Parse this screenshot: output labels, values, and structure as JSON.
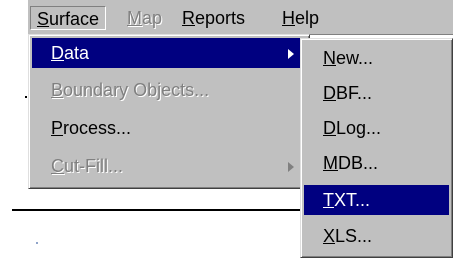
{
  "menubar": {
    "items": [
      {
        "accel": "S",
        "rest": "urface"
      },
      {
        "accel": "M",
        "rest": "ap"
      },
      {
        "accel": "R",
        "rest": "eports"
      },
      {
        "accel": "H",
        "rest": "elp"
      }
    ]
  },
  "surface_menu": {
    "items": [
      {
        "accel": "D",
        "rest": "ata"
      },
      {
        "accel": "B",
        "rest": "oundary Objects..."
      },
      {
        "accel": "P",
        "rest": "rocess..."
      },
      {
        "accel": "C",
        "rest": "ut-Fill..."
      }
    ]
  },
  "data_submenu": {
    "items": [
      {
        "accel": "N",
        "rest": "ew..."
      },
      {
        "accel": "D",
        "rest": "BF..."
      },
      {
        "accel": "D",
        "rest": "Log..."
      },
      {
        "accel": "M",
        "rest": "DB..."
      },
      {
        "accel": "T",
        "rest": "XT..."
      },
      {
        "accel": "X",
        "rest": "LS..."
      }
    ]
  },
  "colors": {
    "menu_face": "#c0c0c0",
    "highlight": "#000080",
    "disabled_text": "#808080"
  }
}
